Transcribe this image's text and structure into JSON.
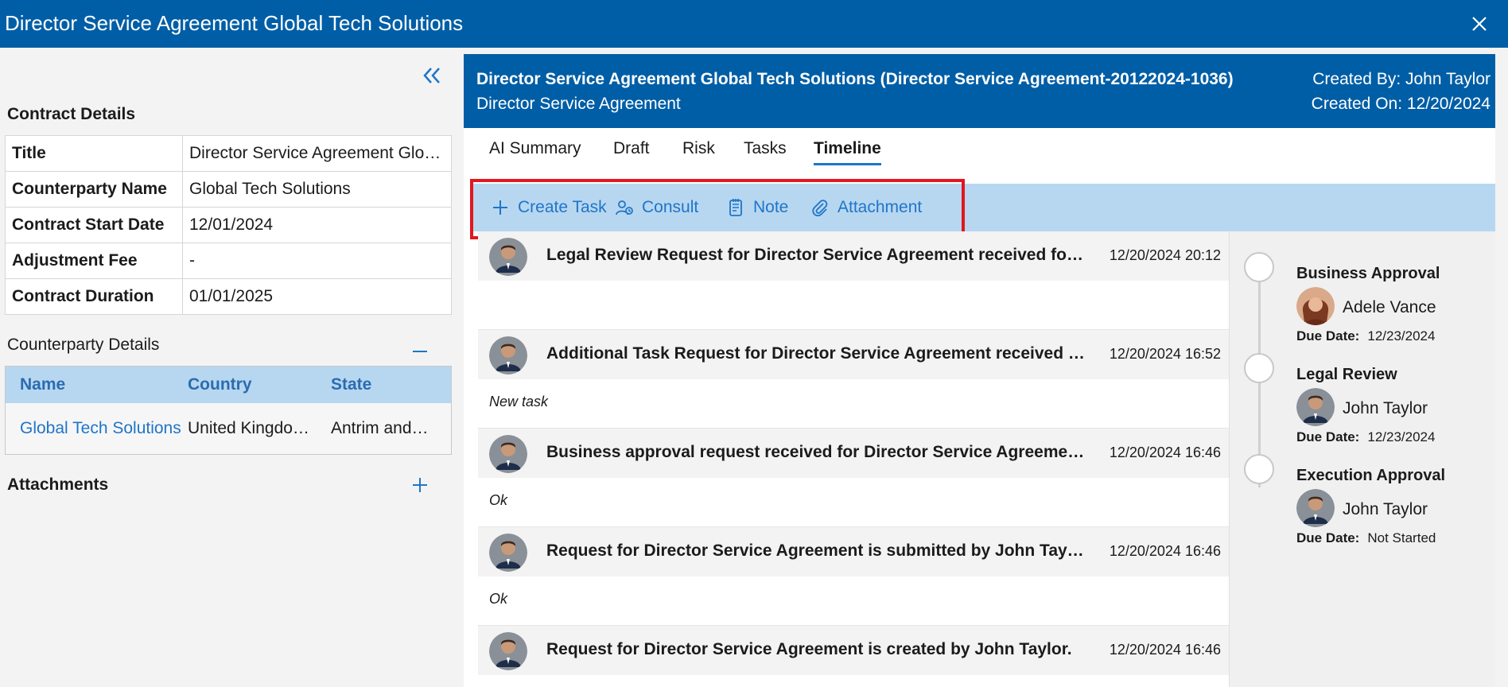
{
  "window": {
    "title": "Director Service Agreement Global Tech Solutions"
  },
  "sections": {
    "contract_details": "Contract Details",
    "counterparty_details": "Counterparty Details",
    "attachments": "Attachments"
  },
  "contract_details": [
    {
      "key": "Title",
      "value": "Director Service Agreement Glob…"
    },
    {
      "key": "Counterparty Name",
      "value": "Global Tech Solutions"
    },
    {
      "key": "Contract Start Date",
      "value": "12/01/2024"
    },
    {
      "key": "Adjustment Fee",
      "value": "-"
    },
    {
      "key": "Contract Duration",
      "value": "01/01/2025"
    }
  ],
  "counterparty_table": {
    "headers": [
      "Name",
      "Country",
      "State"
    ],
    "rows": [
      {
        "name": "Global Tech Solutions",
        "country": "United Kingdo…",
        "state": "Antrim and…"
      }
    ]
  },
  "header": {
    "title": "Director Service Agreement Global Tech Solutions (Director Service Agreement-20122024-1036)",
    "subtitle": "Director Service Agreement",
    "created_by": "Created By: John Taylor",
    "created_on": "Created On: 12/20/2024"
  },
  "tabs": [
    "AI Summary",
    "Draft",
    "Risk",
    "Tasks",
    "Timeline"
  ],
  "active_tab": "Timeline",
  "toolbar": {
    "create_task": "Create Task",
    "consult": "Consult",
    "note": "Note",
    "attachment": "Attachment"
  },
  "timeline": [
    {
      "message": "Legal Review Request for Director Service Agreement received for Ad…",
      "time": "12/20/2024 20:12",
      "note": ""
    },
    {
      "message": "Additional Task Request for Director Service Agreement received for …",
      "time": "12/20/2024 16:52",
      "note": "New task"
    },
    {
      "message": "Business approval request received for Director Service Agreement f…",
      "time": "12/20/2024 16:46",
      "note": "Ok"
    },
    {
      "message": "Request for Director Service Agreement is submitted by John Taylor.",
      "time": "12/20/2024 16:46",
      "note": "Ok"
    },
    {
      "message": "Request for Director Service Agreement is created by John Taylor.",
      "time": "12/20/2024 16:46",
      "note": ""
    }
  ],
  "approvals": [
    {
      "title": "Business Approval",
      "person": "Adele Vance",
      "due_label": "Due Date:",
      "due": "12/23/2024"
    },
    {
      "title": "Legal Review",
      "person": "John Taylor",
      "due_label": "Due Date:",
      "due": "12/23/2024"
    },
    {
      "title": "Execution Approval",
      "person": "John Taylor",
      "due_label": "Due Date:",
      "due": "Not Started"
    }
  ],
  "colors": {
    "brand": "#005ea6",
    "accent": "#1f75c9",
    "toolbar_bg": "#b7d7f0",
    "highlight": "#e3161e"
  }
}
